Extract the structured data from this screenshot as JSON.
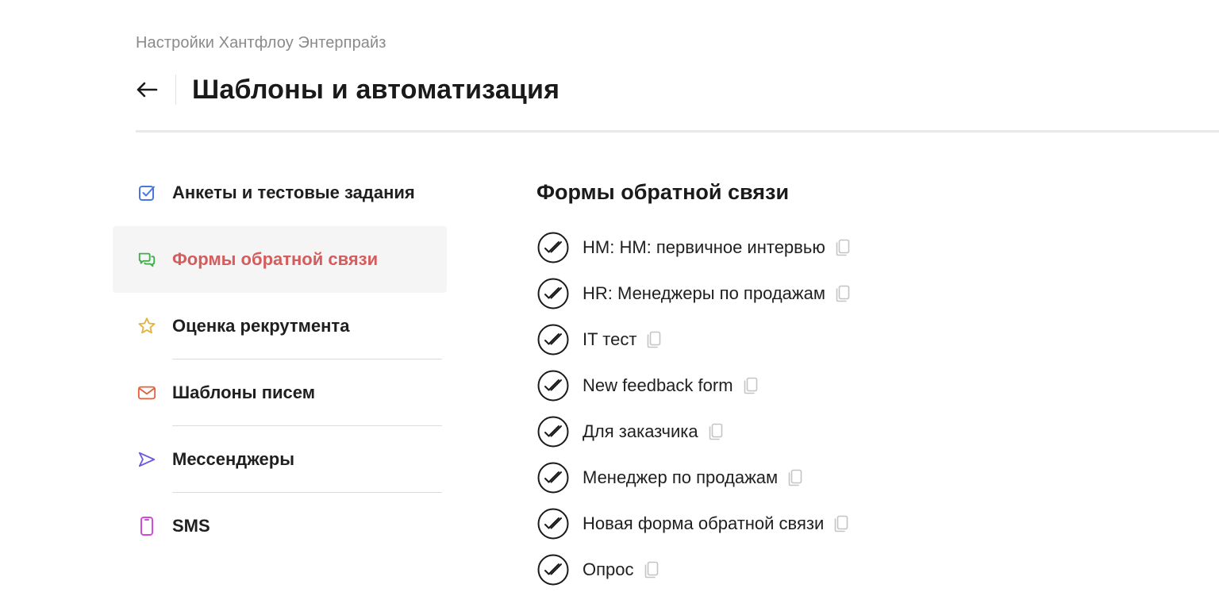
{
  "breadcrumb": "Настройки Хантфлоу Энтерпрайз",
  "header": {
    "title": "Шаблоны и автоматизация"
  },
  "sidebar": {
    "items": [
      {
        "label": "Анкеты и тестовые задания",
        "icon": "checkbox-icon",
        "color": "#4a78e0"
      },
      {
        "label": "Формы обратной связи",
        "icon": "chat-icon",
        "color": "#3fae4a",
        "active": true
      },
      {
        "label": "Оценка рекрутмента",
        "icon": "star-icon",
        "color": "#e3b33b"
      },
      {
        "label": "Шаблоны писем",
        "icon": "mail-icon",
        "color": "#e2623c"
      },
      {
        "label": "Мессенджеры",
        "icon": "send-icon",
        "color": "#6a5ae0"
      },
      {
        "label": "SMS",
        "icon": "phone-icon",
        "color": "#d14ad8"
      }
    ]
  },
  "main": {
    "title": "Формы обратной связи",
    "forms": [
      "HM: HM: первичное интервью",
      "HR: Менеджеры по продажам",
      "IT тест",
      "New feedback form",
      "Для заказчика",
      "Менеджер по продажам",
      "Новая форма обратной связи",
      "Опрос"
    ]
  },
  "colors": {
    "active_text": "#d45c5c",
    "active_bg": "#f5f5f5"
  }
}
